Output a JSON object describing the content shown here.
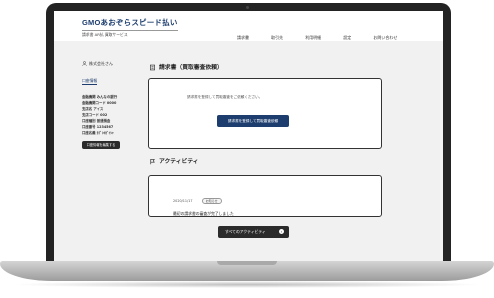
{
  "header": {
    "logo_main": "GMOあおぞらスピード払い",
    "logo_sub": "請求書 AR払 買取サービス",
    "nav": [
      "請求書",
      "取引先",
      "利用明細",
      "設定",
      "お問い合わせ"
    ]
  },
  "sidebar": {
    "user_name": "株式会社さん",
    "menu_label": "口座情報",
    "info_lines": [
      "金融機関 みんなの銀行",
      "金融機関コード 0000",
      "支店名 アイス",
      "支店コード 002",
      "口座種別 普通預金",
      "口座番号 1234567",
      "口座名義 ｶﾌﾞｼｷｶﾞｲｼｬ"
    ],
    "button_label": "口座情報を編集する"
  },
  "main": {
    "invoice_title": "請求書（買取審査依頼）",
    "invoice_text": "請求書を登録して買取審査をご依頼ください。",
    "invoice_button": "請求書を登録して買取審査依頼",
    "activity_title": "アクティビティ",
    "activity": {
      "date": "2020/11/17",
      "badge": "お知らせ",
      "text": "最初の請求書の審査が完了しました"
    },
    "all_activity_button": "すべてのアクティビティ"
  }
}
